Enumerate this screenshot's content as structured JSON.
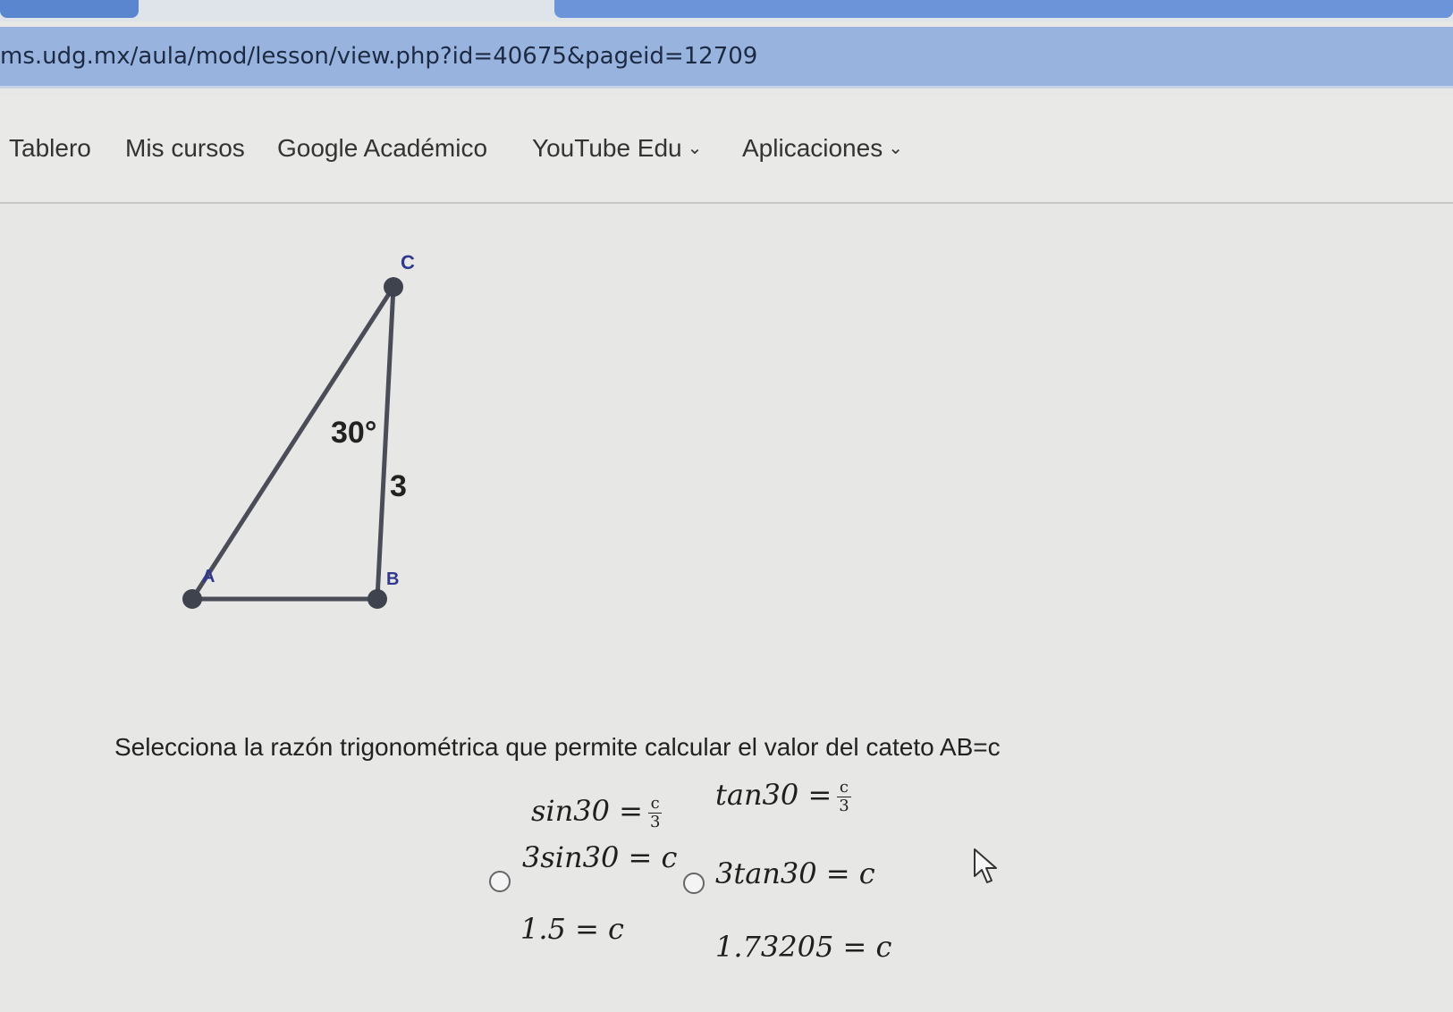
{
  "browser": {
    "url": "ms.udg.mx/aula/mod/lesson/view.php?id=40675&pageid=12709"
  },
  "nav": {
    "items": [
      {
        "label": "Tablero"
      },
      {
        "label": "Mis cursos"
      },
      {
        "label": "Google Académico"
      },
      {
        "label": "YouTube Edu",
        "has_dropdown": true
      },
      {
        "label": "Aplicaciones",
        "has_dropdown": true
      }
    ]
  },
  "diagram": {
    "vertex_a": "A",
    "vertex_b": "B",
    "vertex_c": "C",
    "angle_label": "30°",
    "side_label": "3"
  },
  "question": {
    "text": "Selecciona la razón trigonométrica que permite calcular el valor del cateto AB=c",
    "options": [
      {
        "line1": "sin30 =",
        "frac_num": "c",
        "frac_den": "3",
        "line2": "3sin30 = c",
        "line3": "1.5 = c"
      },
      {
        "line1": "tan30 =",
        "frac_num": "c",
        "frac_den": "3",
        "line2": "3tan30 = c",
        "line3": "1.73205 = c"
      }
    ]
  },
  "colors": {
    "address_bar": "#98b4de",
    "tab_accent": "#5a86cf",
    "background": "#e7e7e5"
  }
}
